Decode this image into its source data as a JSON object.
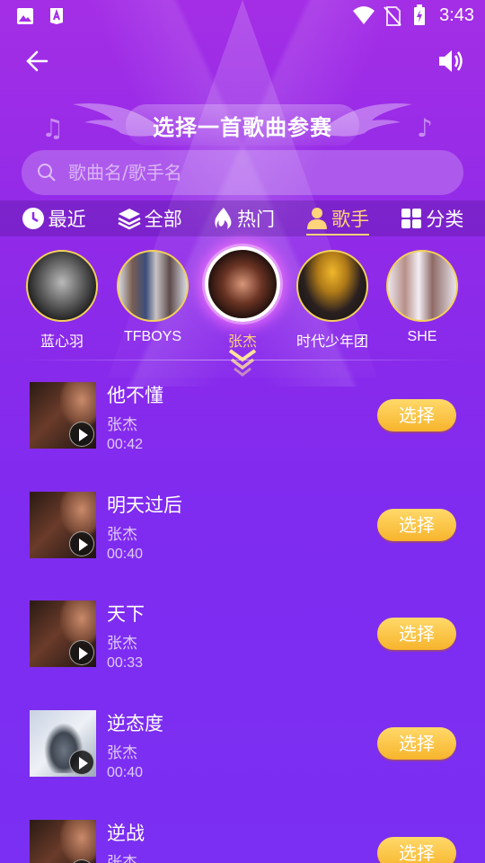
{
  "status_bar": {
    "time": "3:43",
    "icons": [
      "image-icon",
      "app-store-icon",
      "wifi-icon",
      "no-sim-icon",
      "battery-charging-icon"
    ]
  },
  "header": {
    "title": "选择一首歌曲参赛",
    "back_icon": "arrow-left-icon",
    "sound_icon": "speaker-icon"
  },
  "search": {
    "placeholder": "歌曲名/歌手名",
    "value": ""
  },
  "tabs": [
    {
      "label": "最近",
      "icon": "clock-icon",
      "active": false
    },
    {
      "label": "全部",
      "icon": "layers-icon",
      "active": false
    },
    {
      "label": "热门",
      "icon": "flame-icon",
      "active": false
    },
    {
      "label": "歌手",
      "icon": "person-icon",
      "active": true
    },
    {
      "label": "分类",
      "icon": "grid-icon",
      "active": false
    }
  ],
  "singers": [
    {
      "name": "蓝心羽",
      "active": false
    },
    {
      "name": "TFBOYS",
      "active": false
    },
    {
      "name": "张杰",
      "active": true
    },
    {
      "name": "时代少年团",
      "active": false
    },
    {
      "name": "SHE",
      "active": false
    }
  ],
  "songs": [
    {
      "title": "他不懂",
      "artist": "张杰",
      "duration": "00:42",
      "button": "选择"
    },
    {
      "title": "明天过后",
      "artist": "张杰",
      "duration": "00:40",
      "button": "选择"
    },
    {
      "title": "天下",
      "artist": "张杰",
      "duration": "00:33",
      "button": "选择"
    },
    {
      "title": "逆态度",
      "artist": "张杰",
      "duration": "00:40",
      "button": "选择"
    },
    {
      "title": "逆战",
      "artist": "张杰",
      "duration": "",
      "button": "选择"
    }
  ],
  "colors": {
    "accent": "#ffd47a",
    "button": "#f7b42c",
    "background_top": "#a42ee6",
    "background_bottom": "#7a2ff2"
  }
}
